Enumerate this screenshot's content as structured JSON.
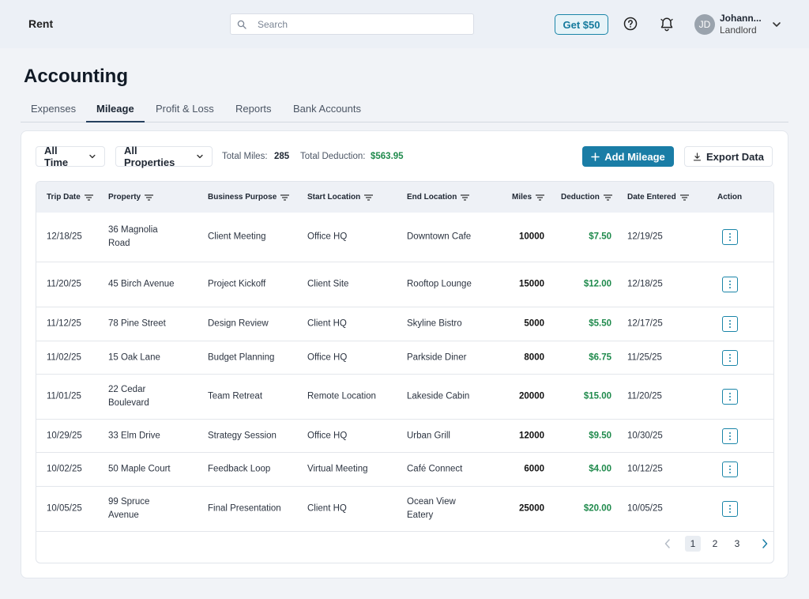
{
  "app": {
    "brand": "Rent",
    "search_placeholder": "Search",
    "promo_label": "Get $50",
    "user": {
      "initials": "JD",
      "name": "Johann...",
      "role": "Landlord"
    }
  },
  "page": {
    "title": "Accounting",
    "tabs": [
      {
        "label": "Expenses",
        "active": false
      },
      {
        "label": "Mileage",
        "active": true
      },
      {
        "label": "Profit & Loss",
        "active": false
      },
      {
        "label": "Reports",
        "active": false
      },
      {
        "label": "Bank Accounts",
        "active": false
      }
    ]
  },
  "filters": {
    "time": "All Time",
    "property": "All Properties",
    "total_miles_label": "Total Miles:",
    "total_miles_value": "285",
    "total_deduction_label": "Total Deduction:",
    "total_deduction_value": "$563.95"
  },
  "actions": {
    "add_label": "Add Mileage",
    "export_label": "Export Data"
  },
  "table": {
    "columns": [
      "Trip Date",
      "Property",
      "Business Purpose",
      "Start Location",
      "End Location",
      "Miles",
      "Deduction",
      "Date Entered",
      "Action"
    ],
    "rows": [
      {
        "trip_date": "12/18/25",
        "property": "36 Magnolia Road",
        "purpose": "Client Meeting",
        "start": "Office HQ",
        "end": "Downtown Cafe",
        "miles": "10000",
        "deduction": "$7.50",
        "entered": "12/19/25"
      },
      {
        "trip_date": "11/20/25",
        "property": "45 Birch Avenue",
        "purpose": "Project Kickoff",
        "start": "Client Site",
        "end": "Rooftop Lounge",
        "miles": "15000",
        "deduction": "$12.00",
        "entered": "12/18/25"
      },
      {
        "trip_date": "11/12/25",
        "property": "78 Pine Street",
        "purpose": "Design Review",
        "start": "Client HQ",
        "end": "Skyline Bistro",
        "miles": "5000",
        "deduction": "$5.50",
        "entered": "12/17/25"
      },
      {
        "trip_date": "11/02/25",
        "property": "15 Oak Lane",
        "purpose": "Budget Planning",
        "start": "Office HQ",
        "end": "Parkside Diner",
        "miles": "8000",
        "deduction": "$6.75",
        "entered": "11/25/25"
      },
      {
        "trip_date": "11/01/25",
        "property": "22 Cedar Boulevard",
        "purpose": "Team Retreat",
        "start": "Remote Location",
        "end": "Lakeside Cabin",
        "miles": "20000",
        "deduction": "$15.00",
        "entered": "11/20/25"
      },
      {
        "trip_date": "10/29/25",
        "property": "33 Elm Drive",
        "purpose": "Strategy Session",
        "start": "Office HQ",
        "end": "Urban Grill",
        "miles": "12000",
        "deduction": "$9.50",
        "entered": "10/30/25"
      },
      {
        "trip_date": "10/02/25",
        "property": "50 Maple Court",
        "purpose": "Feedback Loop",
        "start": "Virtual Meeting",
        "end": "Café Connect",
        "miles": "6000",
        "deduction": "$4.00",
        "entered": "10/12/25"
      },
      {
        "trip_date": "10/05/25",
        "property": "99 Spruce Avenue",
        "purpose": "Final Presentation",
        "start": "Client HQ",
        "end": "Ocean View Eatery",
        "miles": "25000",
        "deduction": "$20.00",
        "entered": "10/05/25"
      }
    ]
  },
  "pagination": {
    "pages": [
      "1",
      "2",
      "3"
    ],
    "current": "1"
  },
  "colors": {
    "accent": "#1a7da6",
    "positive": "#1f8a4c"
  }
}
